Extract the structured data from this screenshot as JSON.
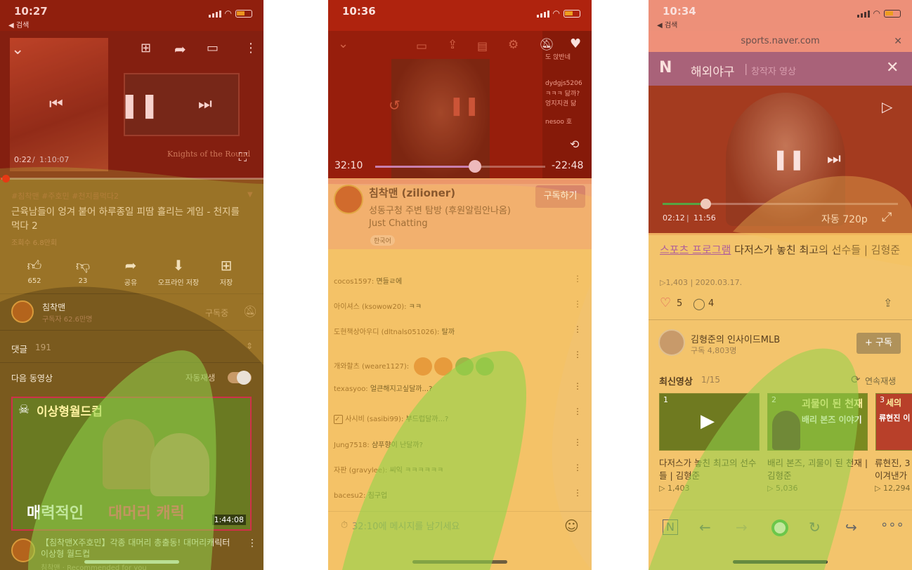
{
  "phone1": {
    "status": {
      "time": "10:27",
      "back": "◀ 검색"
    },
    "player": {
      "current": "0:22",
      "total": "1:10:07",
      "progress": 0.005,
      "game_caption": "Knights of the Round"
    },
    "hashtags": "#침착맨 #주호민 #천지를먹다2",
    "title": "근육남들이 엉겨 붙어 하루종일 피땀 흘리는 게임 - 천지를 먹다 2",
    "views": "조회수 6.8만회",
    "actions": [
      {
        "icon": "thumbs-up-icon",
        "label": "652"
      },
      {
        "icon": "thumbs-down-icon",
        "label": "23"
      },
      {
        "icon": "share-icon",
        "label": "공유"
      },
      {
        "icon": "download-icon",
        "label": "오프라인 저장"
      },
      {
        "icon": "save-icon",
        "label": "저장"
      }
    ],
    "channel": {
      "name": "침착맨",
      "subs": "구독자 62.6만명",
      "subscribed": "구독중"
    },
    "comments": {
      "label": "댓글",
      "count": "191"
    },
    "upnext": {
      "label": "다음 동영상",
      "autoplay": "자동재생"
    },
    "next_video": {
      "banner": "이상형월드컵",
      "caption_a": "매력적인",
      "caption_b": "대머리 캐릭",
      "duration": "1:44:08",
      "title": "【침착맨X주호민】각종 대머리 총출동! 대머리캐릭터 이상형 월드컵",
      "meta": "침착맨 · Recommended for you"
    }
  },
  "phone2": {
    "status": {
      "time": "10:36"
    },
    "player": {
      "elapsed": "32:10",
      "remaining": "-22:48",
      "progress": 0.585
    },
    "overlay_chat": [
      "도 앉반네",
      "dydgjs5206",
      "ㅋㅋㅋ 닮까?",
      "엉지지권 닮",
      "nesoo 호"
    ],
    "streamer": {
      "name": "침착맨 (zilioner)",
      "title": "성동구청 주변 탐방 (후원알림안나옴)",
      "category": "Just Chatting",
      "lang": "한국어",
      "subscribe": "구독하기"
    },
    "chat": [
      {
        "user": "cocos1597:",
        "msg": "면들ㄹ에"
      },
      {
        "user": "아이셔스 (ksowow20):",
        "msg": "ㅋㅋ"
      },
      {
        "user": "도현책상아우디 (dltnals051026):",
        "msg": "탈까"
      },
      {
        "user": "개와할츠 (weare1127):",
        "msg": ""
      },
      {
        "user": "texasyoo:",
        "msg": "얼큰해지고싶달까...?"
      },
      {
        "user": "사시비 (sasibi99):",
        "msg": "부드럽달까...?"
      },
      {
        "user": "Jung7518:",
        "msg": "샴푸향이 난달까?"
      },
      {
        "user": "자판 (gravylee):",
        "msg": "씨익 ㅋㅋㅋㅋㅋㅋ"
      },
      {
        "user": "bacesu2:",
        "msg": "침구업"
      }
    ],
    "input_placeholder": "32:10에 메시지를 남기세요"
  },
  "phone3": {
    "status": {
      "time": "10:34",
      "back": "◀ 검색"
    },
    "url": "sports.naver.com",
    "nav": {
      "logo": "N",
      "section": "해외야구",
      "sub": "창작자 영상"
    },
    "player": {
      "current": "02:12",
      "total": "11:56",
      "progress": 0.185,
      "quality": "자동 720p"
    },
    "video": {
      "category": "스포츠 프로그램",
      "title": "다저스가 놓친 최고의 선수들 | 김형준",
      "plays": "1,403",
      "date": "2020.03.17.",
      "likes": "5",
      "comments": "4"
    },
    "channel": {
      "name": "김형준의 인사이드MLB",
      "subs": "구독 4,803명",
      "subscribe": "+ 구독"
    },
    "latest": {
      "label": "최신영상",
      "count": "1/15",
      "autoplay": "연속재생"
    },
    "items": [
      {
        "num": "1",
        "title": "다저스가 놓친 최고의 선수들 | 김형준",
        "plays": "1,403"
      },
      {
        "num": "2",
        "overlay": "괴물이 된 천재",
        "overlay2": "배리 본즈 이야기",
        "title": "배리 본즈, 괴물이 된 천재 | 김형준",
        "plays": "5,036"
      },
      {
        "num": "3",
        "overlay": "세의",
        "overlay2": "류현진 이",
        "title": "류현진, 3 이겨낸가",
        "plays": "12,294"
      }
    ]
  }
}
